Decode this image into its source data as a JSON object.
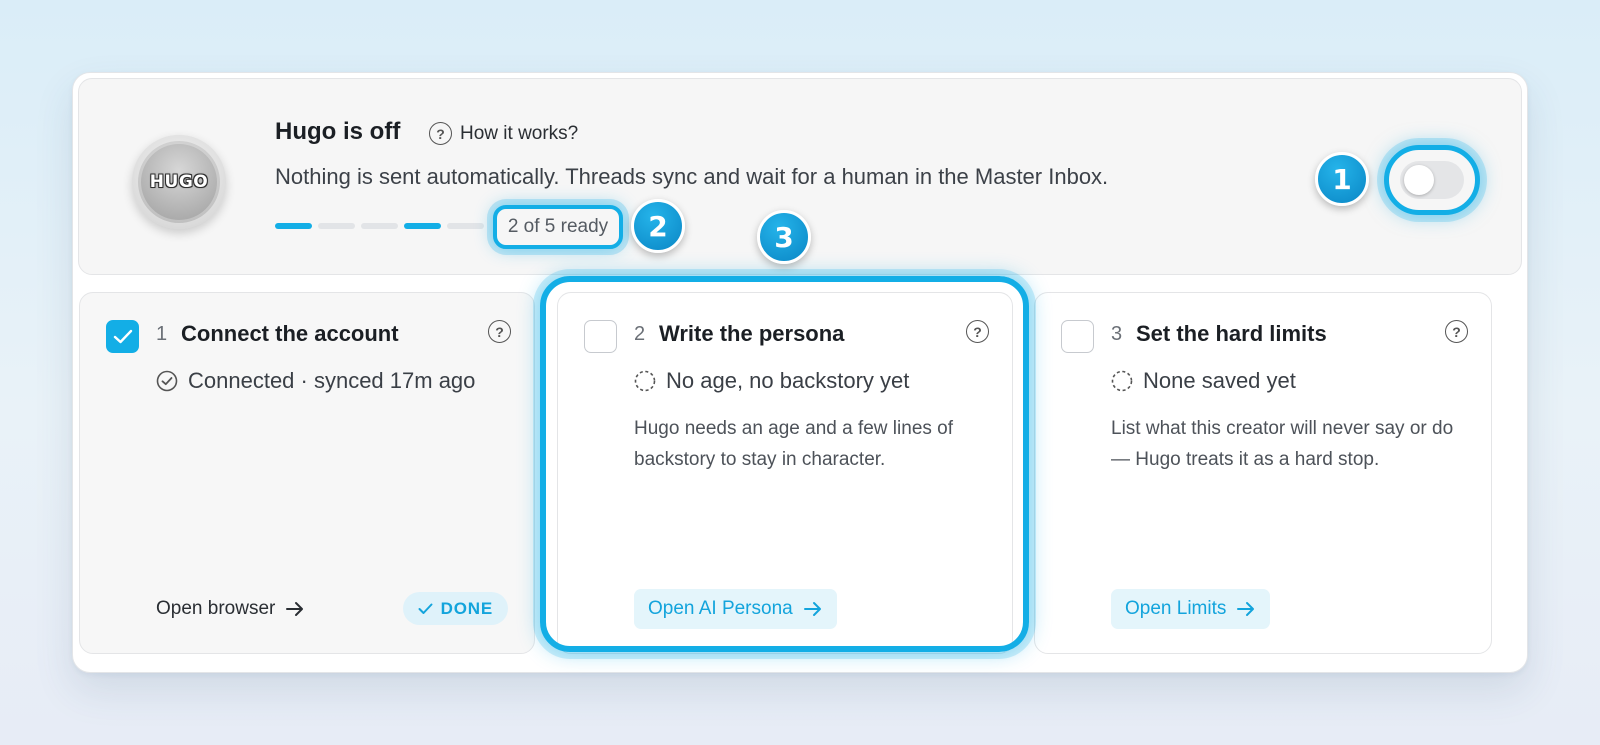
{
  "header": {
    "logo_text": "HUGO",
    "title": "Hugo is off",
    "how_it_works": "How it works?",
    "subtitle": "Nothing is sent automatically. Threads sync and wait for a human in the Master Inbox.",
    "progress": {
      "ready": 2,
      "total": 5,
      "segments": [
        true,
        false,
        false,
        true,
        false
      ]
    },
    "ready_label": "2 of 5 ready",
    "toggle_on": false
  },
  "badges": {
    "b1": "1",
    "b2": "2",
    "b3": "3"
  },
  "steps": [
    {
      "num": "1",
      "title": "Connect the account",
      "checked": true,
      "status": "Connected · synced 17m ago",
      "description": "",
      "action": "Open browser",
      "done_label": "DONE"
    },
    {
      "num": "2",
      "title": "Write the persona",
      "checked": false,
      "status": "No age, no backstory yet",
      "description": "Hugo needs an age and a few lines of backstory to stay in character.",
      "action": "Open AI Persona"
    },
    {
      "num": "3",
      "title": "Set the hard limits",
      "checked": false,
      "status": "None saved yet",
      "description": "List what this creator will never say or do — Hugo treats it as a hard stop.",
      "action": "Open Limits"
    }
  ],
  "colors": {
    "accent": "#13aee6",
    "accent_dark": "#0a86c5",
    "panel_bg": "#f6f6f6"
  }
}
